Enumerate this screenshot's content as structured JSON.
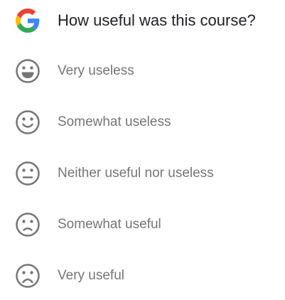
{
  "survey": {
    "logo_icon": "google-g-logo",
    "question": "How useful was this course?",
    "icon_color": "#757575",
    "options": [
      {
        "label": "Very useless",
        "icon": "grinning-face-icon"
      },
      {
        "label": "Somewhat useless",
        "icon": "smiling-face-icon"
      },
      {
        "label": "Neither useful nor useless",
        "icon": "neutral-face-icon"
      },
      {
        "label": "Somewhat useful",
        "icon": "slightly-frowning-face-icon"
      },
      {
        "label": "Very useful",
        "icon": "frowning-face-icon"
      }
    ]
  }
}
